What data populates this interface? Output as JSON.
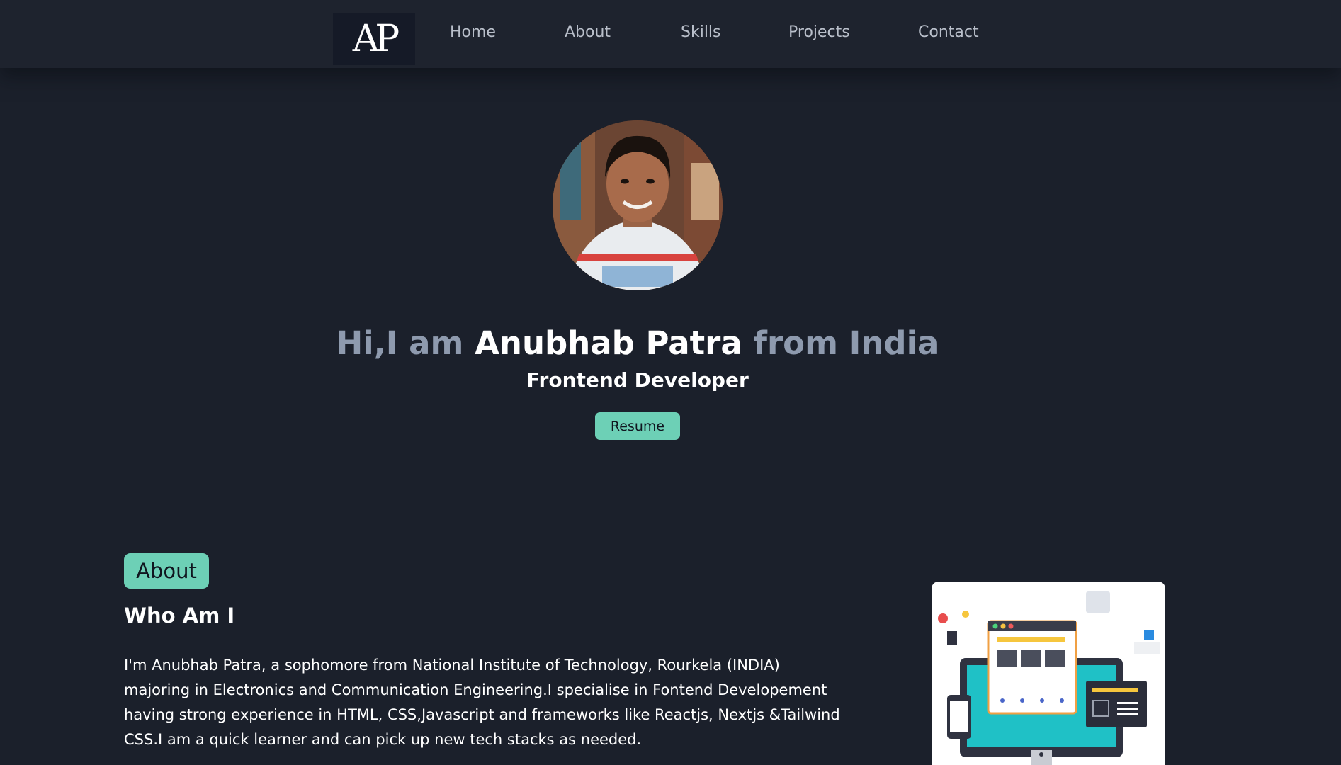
{
  "nav": {
    "logo": "AP",
    "links": [
      "Home",
      "About",
      "Skills",
      "Projects",
      "Contact"
    ]
  },
  "hero": {
    "greeting_prefix": "Hi,I am",
    "name": "Anubhab Patra",
    "greeting_suffix": "from India",
    "subtitle": "Frontend Developer",
    "resume_label": "Resume"
  },
  "about": {
    "badge": "About",
    "heading": "Who Am I",
    "text": "I'm Anubhab Patra, a sophomore from National Institute of Technology, Rourkela (INDIA) majoring in Electronics and Communication Engineering.I specialise in Fontend Developement having strong experience in HTML, CSS,Javascript and frameworks like Reactjs, Nextjs &Tailwind CSS.I am a quick learner and can pick up new tech stacks as needed."
  },
  "colors": {
    "background": "#1b202b",
    "navbar": "#1e232e",
    "accent": "#6dd0b6",
    "muted_text": "#8e9aae"
  }
}
